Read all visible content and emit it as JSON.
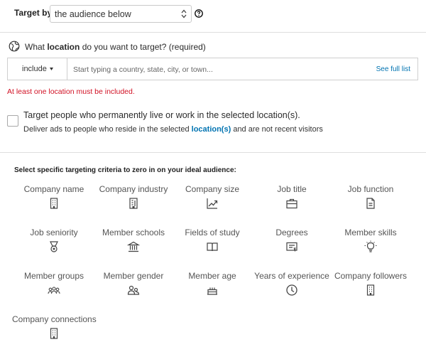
{
  "target": {
    "label": "Target by",
    "selected": "the audience below"
  },
  "location": {
    "prefix": "What ",
    "bold": "location",
    "suffix": " do you want to target? (required)",
    "include_label": "include",
    "input_placeholder": "Start typing a country, state, city, or town...",
    "see_full_list": "See full list",
    "error": "At least one location must be included."
  },
  "permanent": {
    "title": "Target people who permanently live or work in the selected location(s).",
    "desc_prefix": "Deliver ads to people who reside in the selected ",
    "desc_link": "location(s)",
    "desc_suffix": " and are not recent visitors"
  },
  "criteria": {
    "heading": "Select specific targeting criteria to zero in on your ideal audience:",
    "items": [
      {
        "label": "Company name",
        "icon": "building-icon"
      },
      {
        "label": "Company industry",
        "icon": "industry-icon"
      },
      {
        "label": "Company size",
        "icon": "chart-up-icon"
      },
      {
        "label": "Job title",
        "icon": "briefcase-icon"
      },
      {
        "label": "Job function",
        "icon": "document-icon"
      },
      {
        "label": "Job seniority",
        "icon": "medal-icon"
      },
      {
        "label": "Member schools",
        "icon": "school-icon"
      },
      {
        "label": "Fields of study",
        "icon": "book-icon"
      },
      {
        "label": "Degrees",
        "icon": "certificate-icon"
      },
      {
        "label": "Member skills",
        "icon": "lightbulb-icon"
      },
      {
        "label": "Member groups",
        "icon": "group-icon"
      },
      {
        "label": "Member gender",
        "icon": "people-icon"
      },
      {
        "label": "Member age",
        "icon": "cake-icon"
      },
      {
        "label": "Years of experience",
        "icon": "clock-icon"
      },
      {
        "label": "Company followers",
        "icon": "building-icon"
      },
      {
        "label": "Company connections",
        "icon": "building-icon"
      }
    ]
  },
  "colors": {
    "link": "#0073b1",
    "error": "#d11124",
    "icon": "#444444"
  }
}
